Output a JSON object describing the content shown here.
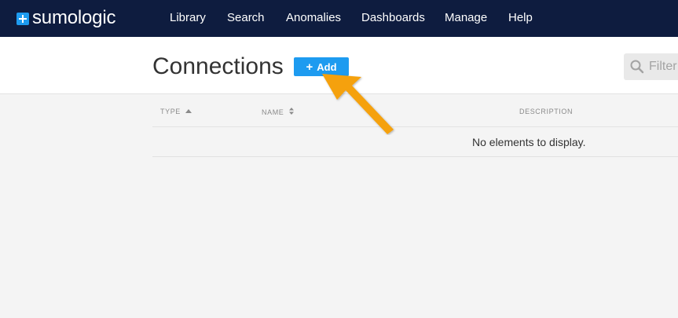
{
  "brand": {
    "logo_text": "sumologic"
  },
  "nav": {
    "items": [
      "Library",
      "Search",
      "Anomalies",
      "Dashboards",
      "Manage",
      "Help"
    ]
  },
  "page": {
    "title": "Connections",
    "add_label": "Add",
    "filter_placeholder": "Filter"
  },
  "table": {
    "columns": [
      {
        "label": "TYPE",
        "sort_icon": "sort-asc-icon"
      },
      {
        "label": "NAME",
        "sort_icon": "sort-both-icon"
      },
      {
        "label": "DESCRIPTION",
        "sort_icon": ""
      }
    ],
    "empty_message": "No elements to display."
  },
  "colors": {
    "nav_bg": "#0e1c3f",
    "accent": "#1d9bf0",
    "annotation_arrow": "#f5a10a"
  }
}
